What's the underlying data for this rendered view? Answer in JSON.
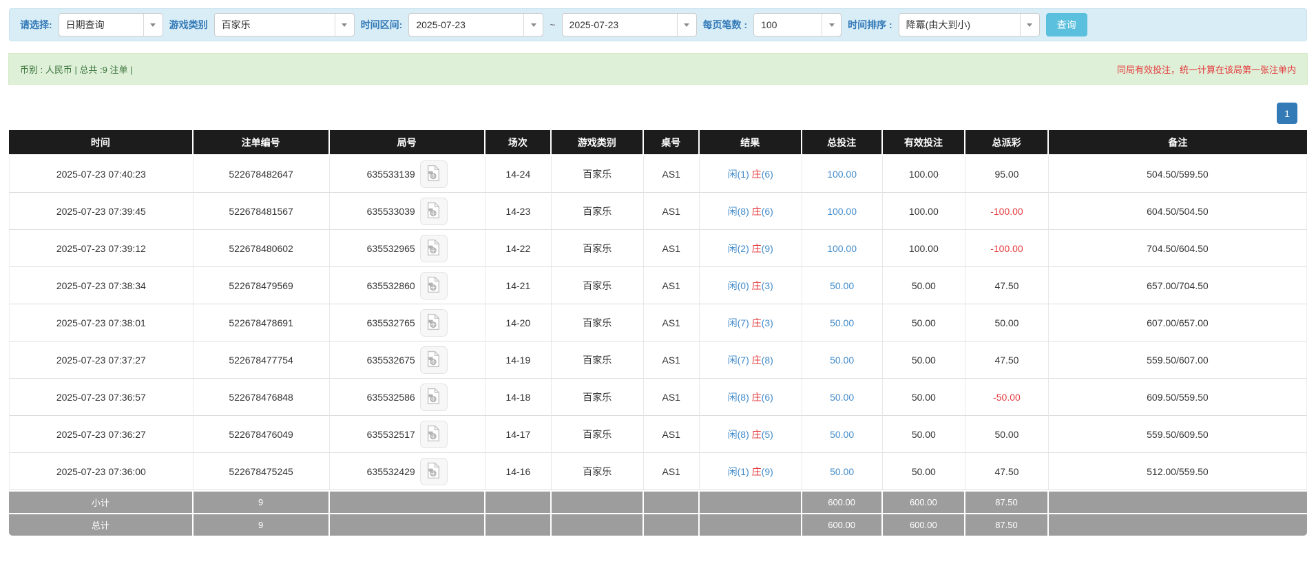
{
  "filter_bar": {
    "select_label": "请选择:",
    "query_type": "日期查询",
    "game_category_label": "游戏类别",
    "game_category": "百家乐",
    "time_range_label": "时间区间:",
    "date_from": "2025-07-23",
    "range_separator": "~",
    "date_to": "2025-07-23",
    "page_size_label": "每页笔数 :",
    "page_size": "100",
    "sort_label": "时间排序 :",
    "sort_order": "降冪(由大到小)",
    "search_button": "查询"
  },
  "summary_bar": {
    "left_text": "币别 : 人民币 | 总共 :9 注单 |",
    "right_text": "同局有效投注，统一计算在该局第一张注单内"
  },
  "pagination": {
    "current_page": "1"
  },
  "table": {
    "headers": [
      "时间",
      "注单编号",
      "局号",
      "场次",
      "游戏类别",
      "桌号",
      "结果",
      "总投注",
      "有效投注",
      "总派彩",
      "备注"
    ],
    "rows": [
      {
        "time": "2025-07-23 07:40:23",
        "bet_id": "522678482647",
        "round_id": "635533139",
        "session": "14-24",
        "game": "百家乐",
        "table_no": "AS1",
        "result_player": "闲(1)",
        "result_banker": "庄",
        "result_banker_num": "(6)",
        "total_bet": "100.00",
        "valid_bet": "100.00",
        "payout": "95.00",
        "remark": "504.50/599.50"
      },
      {
        "time": "2025-07-23 07:39:45",
        "bet_id": "522678481567",
        "round_id": "635533039",
        "session": "14-23",
        "game": "百家乐",
        "table_no": "AS1",
        "result_player": "闲(8)",
        "result_banker": "庄",
        "result_banker_num": "(6)",
        "total_bet": "100.00",
        "valid_bet": "100.00",
        "payout": "-100.00",
        "remark": "604.50/504.50"
      },
      {
        "time": "2025-07-23 07:39:12",
        "bet_id": "522678480602",
        "round_id": "635532965",
        "session": "14-22",
        "game": "百家乐",
        "table_no": "AS1",
        "result_player": "闲(2)",
        "result_banker": "庄",
        "result_banker_num": "(9)",
        "total_bet": "100.00",
        "valid_bet": "100.00",
        "payout": "-100.00",
        "remark": "704.50/604.50"
      },
      {
        "time": "2025-07-23 07:38:34",
        "bet_id": "522678479569",
        "round_id": "635532860",
        "session": "14-21",
        "game": "百家乐",
        "table_no": "AS1",
        "result_player": "闲(0)",
        "result_banker": "庄",
        "result_banker_num": "(3)",
        "total_bet": "50.00",
        "valid_bet": "50.00",
        "payout": "47.50",
        "remark": "657.00/704.50"
      },
      {
        "time": "2025-07-23 07:38:01",
        "bet_id": "522678478691",
        "round_id": "635532765",
        "session": "14-20",
        "game": "百家乐",
        "table_no": "AS1",
        "result_player": "闲(7)",
        "result_banker": "庄",
        "result_banker_num": "(3)",
        "total_bet": "50.00",
        "valid_bet": "50.00",
        "payout": "50.00",
        "remark": "607.00/657.00"
      },
      {
        "time": "2025-07-23 07:37:27",
        "bet_id": "522678477754",
        "round_id": "635532675",
        "session": "14-19",
        "game": "百家乐",
        "table_no": "AS1",
        "result_player": "闲(7)",
        "result_banker": "庄",
        "result_banker_num": "(8)",
        "total_bet": "50.00",
        "valid_bet": "50.00",
        "payout": "47.50",
        "remark": "559.50/607.00"
      },
      {
        "time": "2025-07-23 07:36:57",
        "bet_id": "522678476848",
        "round_id": "635532586",
        "session": "14-18",
        "game": "百家乐",
        "table_no": "AS1",
        "result_player": "闲(8)",
        "result_banker": "庄",
        "result_banker_num": "(6)",
        "total_bet": "50.00",
        "valid_bet": "50.00",
        "payout": "-50.00",
        "remark": "609.50/559.50"
      },
      {
        "time": "2025-07-23 07:36:27",
        "bet_id": "522678476049",
        "round_id": "635532517",
        "session": "14-17",
        "game": "百家乐",
        "table_no": "AS1",
        "result_player": "闲(8)",
        "result_banker": "庄",
        "result_banker_num": "(5)",
        "total_bet": "50.00",
        "valid_bet": "50.00",
        "payout": "50.00",
        "remark": "559.50/609.50"
      },
      {
        "time": "2025-07-23 07:36:00",
        "bet_id": "522678475245",
        "round_id": "635532429",
        "session": "14-16",
        "game": "百家乐",
        "table_no": "AS1",
        "result_player": "闲(1)",
        "result_banker": "庄",
        "result_banker_num": "(9)",
        "total_bet": "50.00",
        "valid_bet": "50.00",
        "payout": "47.50",
        "remark": "512.00/559.50"
      }
    ],
    "subtotal": {
      "label": "小计",
      "count": "9",
      "total_bet": "600.00",
      "valid_bet": "600.00",
      "payout": "87.50"
    },
    "grand_total": {
      "label": "总计",
      "count": "9",
      "total_bet": "600.00",
      "valid_bet": "600.00",
      "payout": "87.50"
    }
  },
  "icons": {
    "chevron-down-icon": "▾",
    "video-file-icon": "🎞"
  },
  "colors": {
    "label_blue": "#337ab7",
    "link_blue": "#428bca",
    "danger_red": "#e4393c",
    "info_bar_bg": "#d9edf7",
    "success_bar_bg": "#dff0d8",
    "success_text": "#3c763d",
    "search_button_cyan": "#5bc0de",
    "table_header_bg": "#1c1c1c",
    "totals_row_bg": "#9d9d9d"
  }
}
